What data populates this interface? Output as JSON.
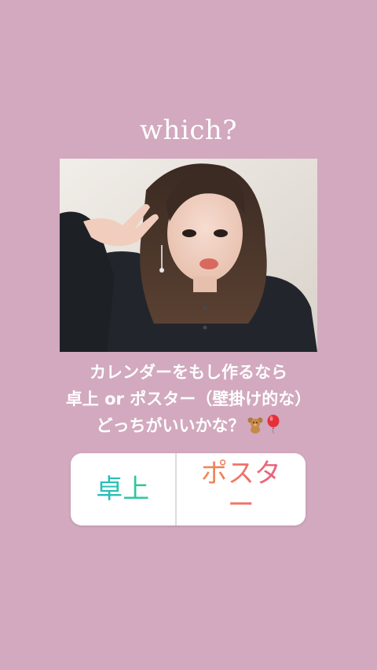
{
  "story": {
    "title": "which?",
    "photo": {
      "alt": "selfie-photo"
    },
    "caption": {
      "line1": "カレンダーをもし作るなら",
      "line2": "卓上 or ポスター（壁掛け的な）",
      "line3": "どっちがいいかな？",
      "emoji": [
        "teddy-bear-icon",
        "balloon-icon"
      ]
    }
  },
  "poll": {
    "options": [
      {
        "label": "卓上",
        "color_from": "#1fb6d8",
        "color_to": "#35d07a"
      },
      {
        "label": "ポスター",
        "color_from": "#f49a43",
        "color_to": "#e6508f"
      }
    ]
  },
  "colors": {
    "background": "#d2a9be",
    "text": "#ffffff"
  }
}
